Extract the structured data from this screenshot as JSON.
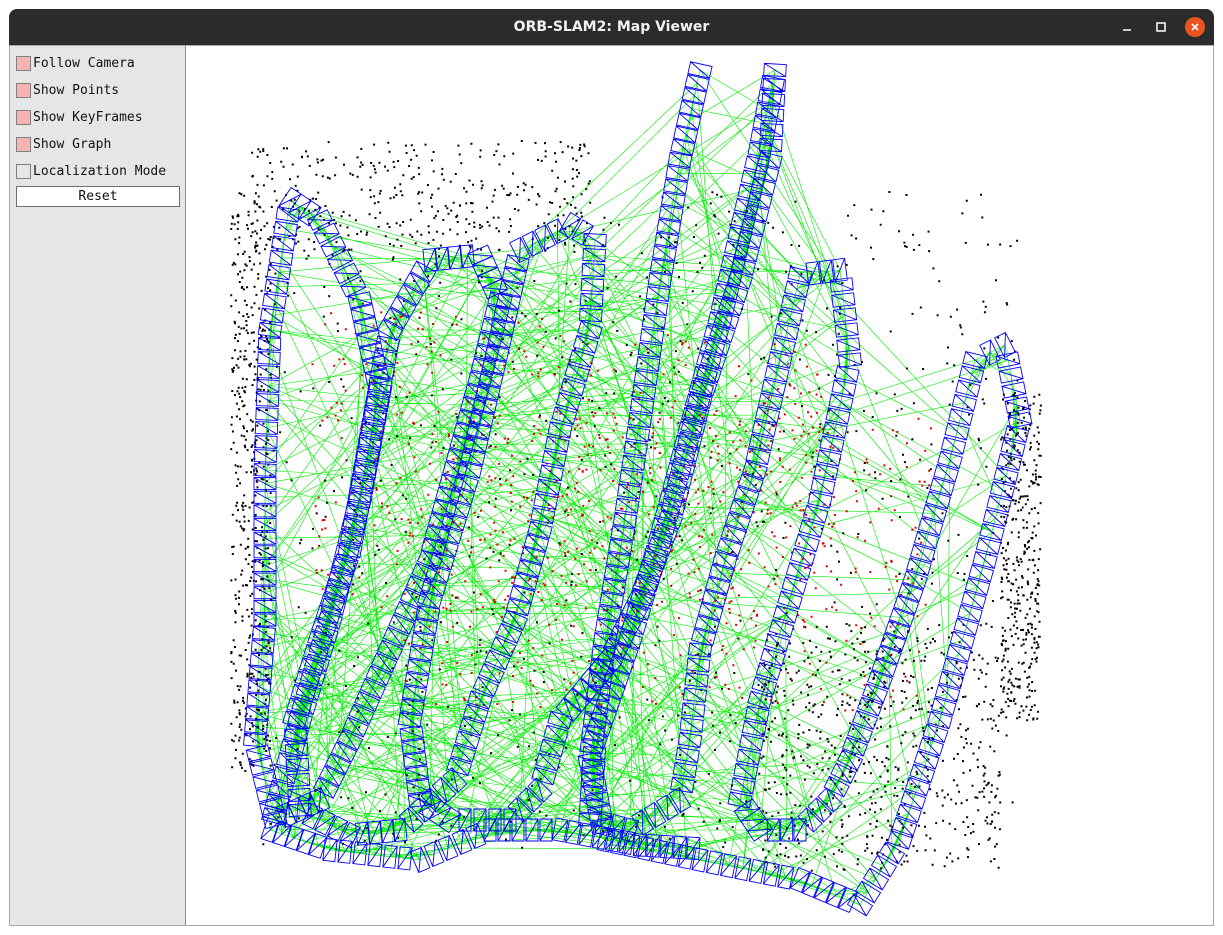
{
  "window": {
    "title": "ORB-SLAM2: Map Viewer",
    "controls": [
      "minimize-icon",
      "maximize-icon",
      "close-icon"
    ],
    "accent_close": "#e95420"
  },
  "panel": {
    "options": [
      {
        "label": "Follow Camera",
        "checked": true
      },
      {
        "label": "Show Points",
        "checked": true
      },
      {
        "label": "Show KeyFrames",
        "checked": true
      },
      {
        "label": "Show Graph",
        "checked": true
      },
      {
        "label": "Localization Mode",
        "checked": false
      }
    ],
    "reset_label": "Reset"
  },
  "viewer": {
    "background": "#ffffff",
    "keyframe_color": "#0000ff",
    "graph_color": "#00ee00",
    "map_point_color": "#000000",
    "reference_point_color": "#dd0000"
  }
}
